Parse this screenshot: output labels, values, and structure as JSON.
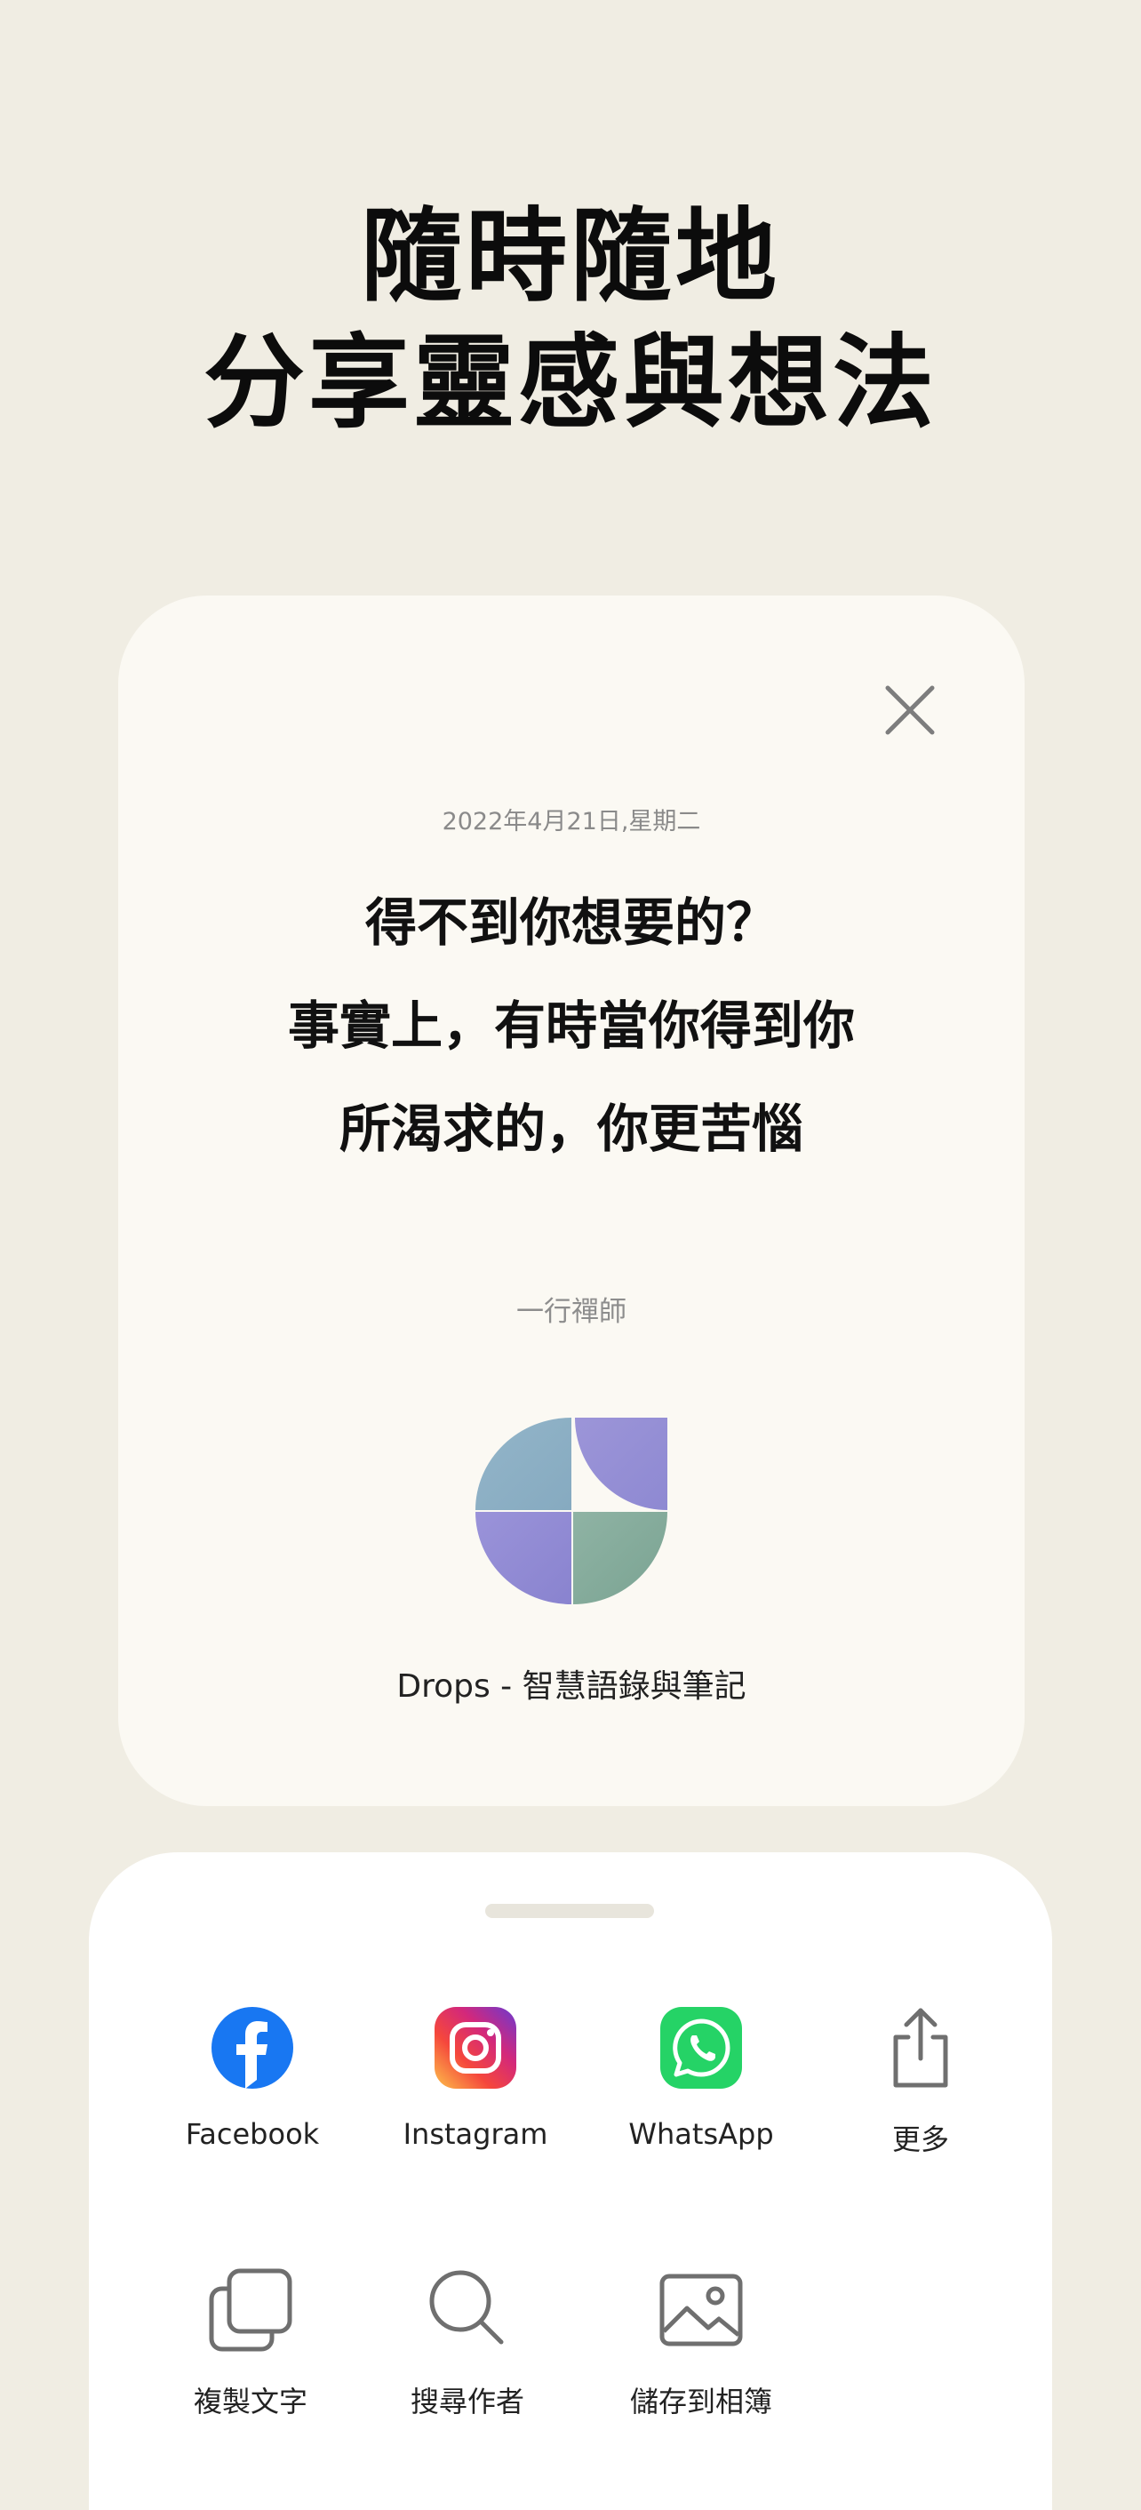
{
  "headline": {
    "line1": "隨時隨地",
    "line2": "分享靈感與想法"
  },
  "card": {
    "close_icon": "close-icon",
    "date": "2022年4月21日,星期二",
    "quote_lines": [
      "得不到你想要的？",
      "事實上，有時當你得到你",
      "所渴求的，你更苦惱"
    ],
    "author": "一行禪師",
    "app_name": "Drops - 智慧語錄與筆記"
  },
  "share_sheet": {
    "row1": [
      {
        "label": "Facebook",
        "icon": "facebook-icon"
      },
      {
        "label": "Instagram",
        "icon": "instagram-icon"
      },
      {
        "label": "WhatsApp",
        "icon": "whatsapp-icon"
      },
      {
        "label": "更多",
        "icon": "share-more-icon"
      }
    ],
    "row2": [
      {
        "label": "複製文字",
        "icon": "copy-icon"
      },
      {
        "label": "搜尋作者",
        "icon": "search-icon"
      },
      {
        "label": "儲存到相簿",
        "icon": "image-icon"
      }
    ]
  },
  "colors": {
    "background": "#f0ede3",
    "card": "#fbf9f3",
    "facebook": "#1877f2",
    "whatsapp": "#25d366"
  }
}
